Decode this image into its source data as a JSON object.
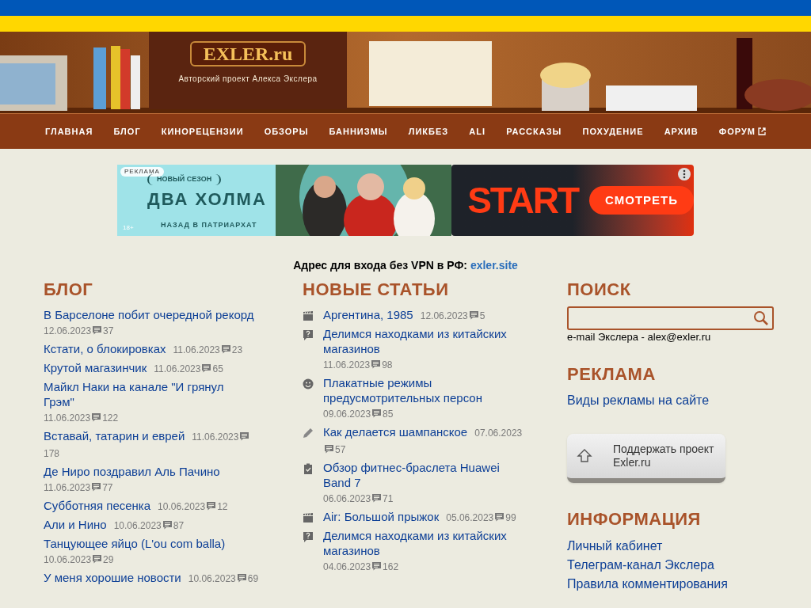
{
  "header": {
    "logo": "EXLER.ru",
    "tagline": "Авторский проект Алекса Экслера"
  },
  "nav": [
    {
      "label": "ГЛАВНАЯ",
      "external": false
    },
    {
      "label": "БЛОГ",
      "external": false
    },
    {
      "label": "КИНОРЕЦЕНЗИИ",
      "external": false
    },
    {
      "label": "ОБЗОРЫ",
      "external": false
    },
    {
      "label": "БАННИЗМЫ",
      "external": false
    },
    {
      "label": "ЛИКБЕЗ",
      "external": false
    },
    {
      "label": "ALI",
      "external": false
    },
    {
      "label": "РАССКАЗЫ",
      "external": false
    },
    {
      "label": "ПОХУДЕНИЕ",
      "external": false
    },
    {
      "label": "АРХИВ",
      "external": false
    },
    {
      "label": "ФОРУМ",
      "external": true
    }
  ],
  "ad": {
    "badge": "РЕКЛАМА",
    "season": "НОВЫЙ СЕЗОН",
    "title": "ДВА ХОЛМА",
    "subtitle": "НАЗАД В ПАТРИАРХАТ",
    "age": "18+",
    "brand": "START",
    "button": "СМОТРЕТЬ"
  },
  "vpn_notice": {
    "text": "Адрес для входа без VPN в РФ:",
    "link": "exler.site"
  },
  "blog": {
    "title": "БЛОГ",
    "posts": [
      {
        "title": "В Барселоне побит очередной рекорд",
        "date": "12.06.2023",
        "comments": "37"
      },
      {
        "title": "Кстати, о блокировках",
        "date": "11.06.2023",
        "comments": "23"
      },
      {
        "title": "Крутой магазинчик",
        "date": "11.06.2023",
        "comments": "65"
      },
      {
        "title": "Майкл Наки на канале \"И грянул Грэм\"",
        "date": "11.06.2023",
        "comments": "122"
      },
      {
        "title": "Вставай, татарин и еврей",
        "date": "11.06.2023",
        "comments": "178"
      },
      {
        "title": "Де Ниро поздравил Аль Пачино",
        "date": "11.06.2023",
        "comments": "77"
      },
      {
        "title": "Субботняя песенка",
        "date": "10.06.2023",
        "comments": "12"
      },
      {
        "title": "Али и Нино",
        "date": "10.06.2023",
        "comments": "87"
      },
      {
        "title": "Танцующее яйцо (L'ou com balla)",
        "date": "10.06.2023",
        "comments": "29"
      },
      {
        "title": "У меня хорошие новости",
        "date": "10.06.2023",
        "comments": "69"
      }
    ]
  },
  "articles": {
    "title": "НОВЫЕ СТАТЬИ",
    "items": [
      {
        "kind": "film",
        "title": "Аргентина, 1985",
        "date": "12.06.2023",
        "comments": "5"
      },
      {
        "kind": "question",
        "title": "Делимся находками из китайских магазинов",
        "date": "11.06.2023",
        "comments": "98"
      },
      {
        "kind": "smile",
        "title": "Плакатные режимы предусмотрительных персон",
        "date": "09.06.2023",
        "comments": "85"
      },
      {
        "kind": "pencil",
        "title": "Как делается шампанское",
        "date": "07.06.2023",
        "comments": "57"
      },
      {
        "kind": "review",
        "title": "Обзор фитнес-браслета Huawei Band 7",
        "date": "06.06.2023",
        "comments": "71"
      },
      {
        "kind": "film",
        "title": "Air: Большой прыжок",
        "date": "05.06.2023",
        "comments": "99"
      },
      {
        "kind": "question",
        "title": "Делимся находками из китайских магазинов",
        "date": "04.06.2023",
        "comments": "162"
      }
    ]
  },
  "sidebar": {
    "search_title": "ПОИСК",
    "email_note": "e-mail Экслера - alex@exler.ru",
    "ads_title": "РЕКЛАМА",
    "ads_link": "Виды рекламы на сайте",
    "support_button": "Поддержать проект Exler.ru",
    "info_title": "ИНФОРМАЦИЯ",
    "info_links": [
      "Личный кабинет",
      "Телеграм-канал Экслера",
      "Правила комментирования"
    ]
  }
}
